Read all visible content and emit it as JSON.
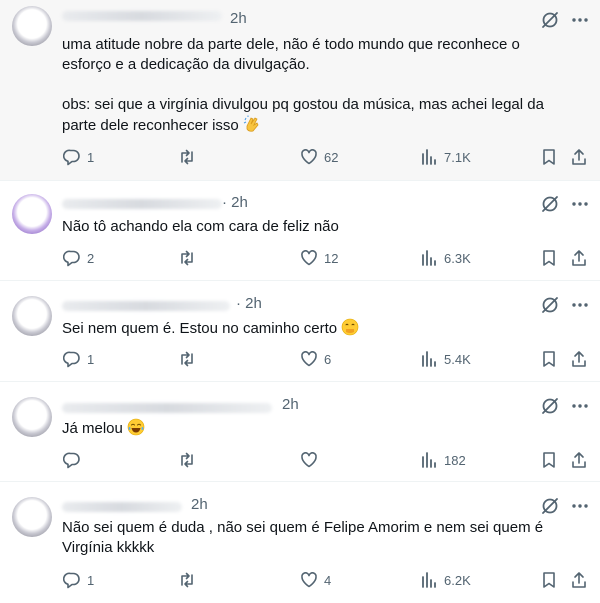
{
  "tweets": [
    {
      "time": "2h",
      "paragraphs": [
        "uma atitude nobre da parte dele, não é todo mundo que reconhece o esforço e a dedicação da divulgação.",
        "obs: sei que a virgínia divulgou pq gostou da música, mas achei legal da parte dele reconhecer isso"
      ],
      "emoji": "clapping-hands",
      "replies": "1",
      "reposts": "",
      "likes": "62",
      "views": "7.1K"
    },
    {
      "time": "· 2h",
      "paragraphs": [
        "Não tô achando ela com cara de feliz não"
      ],
      "emoji": "",
      "replies": "2",
      "reposts": "",
      "likes": "12",
      "views": "6.3K"
    },
    {
      "time": "· 2h",
      "paragraphs": [
        "Sei nem quem é. Estou no caminho certo"
      ],
      "emoji": "face-with-hand-over-mouth",
      "replies": "1",
      "reposts": "",
      "likes": "6",
      "views": "5.4K"
    },
    {
      "time": "2h",
      "paragraphs": [
        "Já melou"
      ],
      "emoji": "tears-of-joy",
      "replies": "",
      "reposts": "",
      "likes": "",
      "views": "182"
    },
    {
      "time": "2h",
      "paragraphs": [
        "Não sei quem é duda , não sei quem é Felipe Amorim e nem sei quem é Virgínia kkkkk"
      ],
      "emoji": "",
      "replies": "1",
      "reposts": "",
      "likes": "4",
      "views": "6.2K"
    }
  ],
  "colors": {
    "text": "#0f1419",
    "secondary": "#536471",
    "divider": "#eff3f4",
    "bg": "#ffffff"
  }
}
